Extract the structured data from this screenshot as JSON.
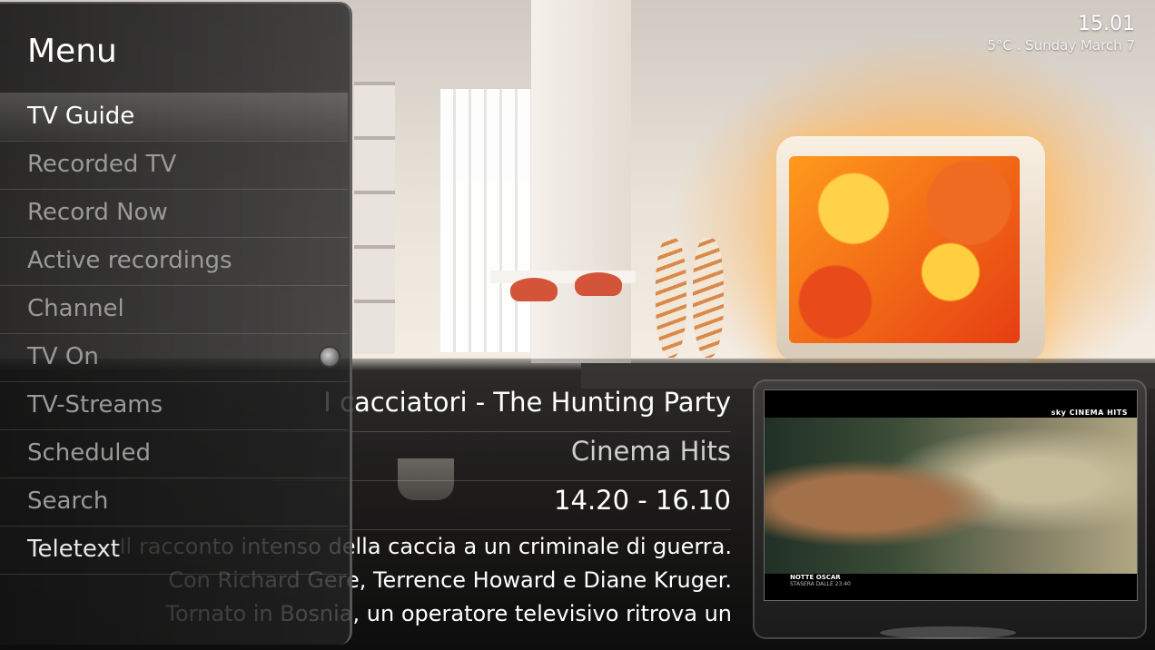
{
  "clock": {
    "time": "15.01",
    "date": "5°C  .  Sunday March 7"
  },
  "menu": {
    "title": "Menu",
    "items": [
      {
        "label": "TV Guide",
        "selected": true
      },
      {
        "label": "Recorded TV"
      },
      {
        "label": "Record Now"
      },
      {
        "label": "Active recordings"
      },
      {
        "label": "Channel"
      },
      {
        "label": "TV On",
        "toggle": "off"
      },
      {
        "label": "TV-Streams"
      },
      {
        "label": "Scheduled"
      },
      {
        "label": "Search"
      },
      {
        "label": "Teletext"
      }
    ]
  },
  "program": {
    "title": "I cacciatori - The Hunting Party",
    "channel": "Cinema Hits",
    "time": "14.20 - 16.10",
    "description": [
      "Il racconto intenso della caccia a un criminale di guerra.",
      "Con Richard Gere, Terrence Howard e Diane Kruger.",
      "Tornato in Bosnia, un operatore televisivo ritrova un"
    ]
  },
  "preview": {
    "logo": "sky CINEMA HITS",
    "caption_title": "NOTTE OSCAR",
    "caption_sub": "STASERA DALLE 23.40"
  }
}
